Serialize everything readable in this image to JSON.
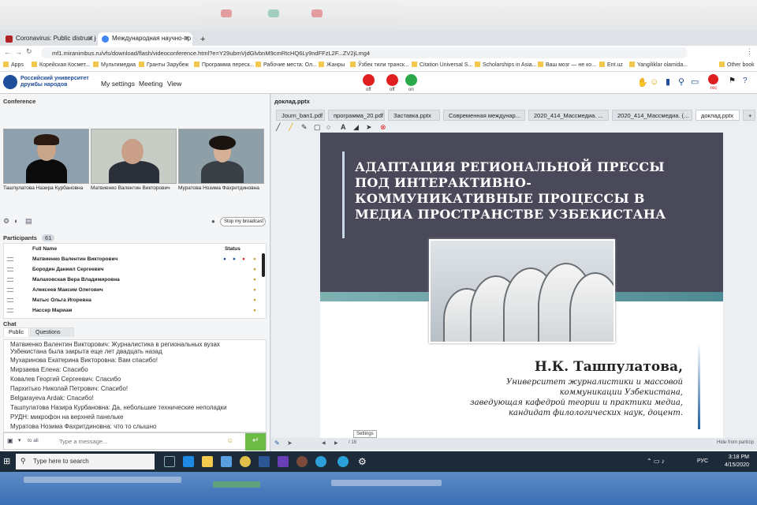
{
  "browser": {
    "tabs": [
      {
        "label": "Coronavirus: Public distrust journ",
        "fav_color": "#b22222"
      },
      {
        "label": "Международная научно-пр",
        "fav_color": "#4285f4"
      }
    ],
    "new_tab": "+",
    "url": "mf1.miranimbus.ru/vfs/download/flash/videoconference.html?e=Y29ubmVjdGlvbnM9cmRtcHQ6Ly9ndFFzL2F...ZV2jLmg4",
    "bookmarks": [
      "Apps",
      "Корейская Космет...",
      "Мультимедиа",
      "Гранты Зарубеж",
      "Программа переск...",
      "Рабочие места: Ол...",
      "Жанры",
      "Ўзбек тили транск...",
      "Citation Universal S...",
      "Scholarships in Asia...",
      "Ваш мозг — не ко...",
      "Ent.uz",
      "Yangiliklar olamida...",
      "Other book"
    ]
  },
  "app": {
    "logo_text": "Российский университет дружбы народов",
    "menu": [
      "My settings",
      "Meeting",
      "View"
    ],
    "controls": [
      {
        "label": "off",
        "color": "#e02020"
      },
      {
        "label": "off",
        "color": "#e02020"
      },
      {
        "label": "on",
        "color": "#2aa84a"
      }
    ],
    "rec_label": "rec"
  },
  "conference": {
    "title": "Conference",
    "participants_video": [
      "Ташпулатова Назира Курбановна",
      "Матвиенко Валентин Викторович",
      "Муратова Нозима Фахритдиновна"
    ],
    "broadcast_button": "Stop my broadcast"
  },
  "participants": {
    "title": "Participants",
    "count": "61",
    "col_name": "Full Name",
    "col_status": "Status",
    "rows": [
      "Матвиенко Валентин Викторович",
      "Бородин Даниил Сергеевич",
      "Малаховская Вера Владимировна",
      "Алексеев Максим Олегович",
      "Матыс Ольга Игоревна",
      "Нассер Мариам"
    ]
  },
  "chat": {
    "title": "Chat",
    "tabs": [
      "Public",
      "Questions"
    ],
    "messages": [
      "Матвиенко Валентин Викторович: Журналистика в региональных вузах",
      "Узбекистана была закрыта еще лет двадцать назад",
      "Мухаринова Екатерина  Викторовна: Вам спасибо!",
      "Мирзаева Елена: Спасибо",
      "Ковалев Георгий  Сергеевич: Спасибо",
      "Пархитько Николай Петрович: Спасибо!",
      "Belgarayeva Ardak: Спасибо!",
      "Ташпулатова  Назира Курбановна: Да, небольшие технические неполадки",
      "РУДН: микрофон на верхней панельке",
      "Муратова Нозима Фахритдиновна: что то слышно"
    ],
    "to_all": "to all",
    "placeholder": "Type a message..."
  },
  "documents": {
    "current": "доклад.pptx",
    "tabs": [
      "Journ_ban1.pdf",
      "программа_20.pdf",
      "Заставка.pptx",
      "Современная междунар...",
      "2020_414_Массмедиа. ...",
      "2020_414_Массмедиа. (...",
      "доклад.pptx",
      "+"
    ]
  },
  "slide": {
    "title": "АДАПТАЦИЯ РЕГИОНАЛЬНОЙ ПРЕССЫ ПОД ИНТЕРАКТИВНО-КОММУНИКАТИВНЫЕ ПРОЦЕССЫ В МЕДИА ПРОСТРАНСТВЕ УЗБЕКИСТАНА",
    "author": "Н.К. Ташпулатова,",
    "affiliation": [
      "Университет журналистики и массовой",
      "коммуникации Узбекистана,",
      "заведующая кафедрой теории и практики медиа,",
      "кандидат филологических наук, доцент."
    ]
  },
  "viewer": {
    "page_indicator": "/ 18",
    "hide_label": "Hide from particip",
    "settings_tooltip": "Settings"
  },
  "taskbar": {
    "search_placeholder": "Type here to search",
    "lang": "РУС",
    "time": "3:18 PM",
    "date": "4/15/2020"
  }
}
